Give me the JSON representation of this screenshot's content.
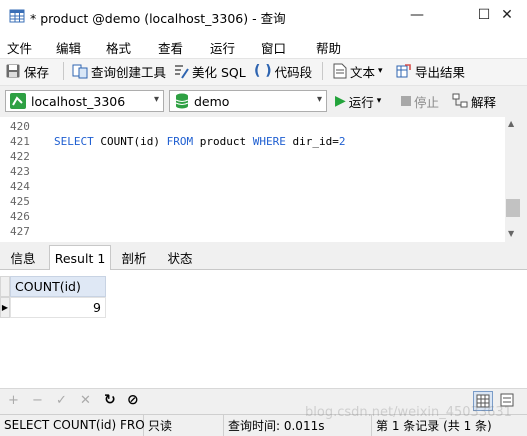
{
  "window": {
    "title": "* product @demo (localhost_3306) - 查询",
    "minimize": "—",
    "maximize": "☐",
    "close": "✕"
  },
  "menu": [
    "文件",
    "编辑",
    "格式",
    "查看",
    "运行",
    "窗口",
    "帮助"
  ],
  "toolbar": {
    "save": "保存",
    "query_builder": "查询创建工具",
    "beautify_sql": "美化 SQL",
    "code_snippet": "代码段",
    "text": "文本",
    "export_results": "导出结果"
  },
  "connection": {
    "server": "localhost_3306",
    "database": "demo",
    "run": "运行",
    "stop": "停止",
    "explain": "解释"
  },
  "editor": {
    "lines": [
      {
        "num": "420",
        "code": ""
      },
      {
        "num": "421",
        "kw1": "SELECT",
        "t1": " COUNT(id) ",
        "kw2": "FROM",
        "t2": " product ",
        "kw3": "WHERE",
        "t3": " dir_id=",
        "n": "2"
      },
      {
        "num": "422",
        "code": ""
      },
      {
        "num": "423",
        "code": ""
      },
      {
        "num": "424",
        "code": ""
      },
      {
        "num": "425",
        "code": ""
      },
      {
        "num": "426",
        "code": ""
      },
      {
        "num": "427",
        "code": ""
      }
    ]
  },
  "result_tabs": [
    "信息",
    "Result 1",
    "剖析",
    "状态"
  ],
  "result": {
    "column": "COUNT(id)",
    "value": "9"
  },
  "bottom_actions": [
    "+",
    "−",
    "✓",
    "✕",
    "↻",
    "⊘"
  ],
  "status": {
    "sql": "SELECT COUNT(id) FRO",
    "mode": "只读",
    "query_time": "查询时间: 0.011s",
    "record": "第 1 条记录 (共 1 条)",
    "watermark": "blog.csdn.net/weixin_45033631"
  }
}
